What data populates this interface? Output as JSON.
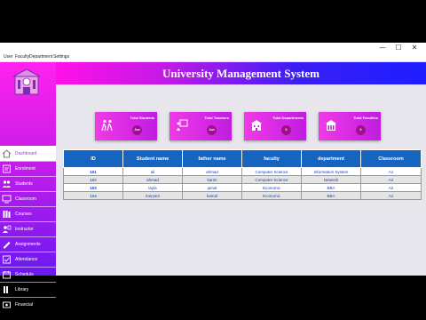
{
  "window": {
    "controls": {
      "minimize": "—",
      "maximize": "☐",
      "close": "✕"
    }
  },
  "menu": [
    "User",
    "Faculty",
    "Department",
    "Settings"
  ],
  "sidebar": {
    "logo_icon": "university-building-logo",
    "items": [
      {
        "label": "Dashboard",
        "icon": "home-icon",
        "active": true
      },
      {
        "label": "Enrolment",
        "icon": "enrolment-icon"
      },
      {
        "label": "Students",
        "icon": "students-icon"
      },
      {
        "label": "Classroom",
        "icon": "classroom-icon"
      },
      {
        "label": "Courses",
        "icon": "courses-icon"
      },
      {
        "label": "Instructor",
        "icon": "instructor-icon"
      },
      {
        "label": "Assignments",
        "icon": "assignments-icon"
      },
      {
        "label": "Attendance",
        "icon": "attendance-icon"
      },
      {
        "label": "Schedule",
        "icon": "schedule-icon"
      },
      {
        "label": "Library",
        "icon": "library-icon"
      },
      {
        "label": "Financial",
        "icon": "financial-icon"
      }
    ]
  },
  "header": {
    "title": "University Management System"
  },
  "cards": [
    {
      "title": "Total Students",
      "value": "Jun",
      "icon": "students-walking-icon"
    },
    {
      "title": "Total Teachers",
      "value": "Jun",
      "icon": "teacher-board-icon"
    },
    {
      "title": "Total Departments",
      "value": "0",
      "icon": "building-icon"
    },
    {
      "title": "Total Faculties",
      "value": "0",
      "icon": "faculty-building-icon"
    }
  ],
  "table": {
    "columns": [
      "ID",
      "Student name",
      "father name",
      "faculty",
      "department",
      "Classroom"
    ],
    "rows": [
      [
        "101",
        "ali",
        "ahmad",
        "Computer Science",
        "Information System",
        "A1"
      ],
      [
        "102",
        "ahmad",
        "karim",
        "Computer Science",
        "Network",
        "A2"
      ],
      [
        "103",
        "layla",
        "jamal",
        "Economic",
        "BBA",
        "A2"
      ],
      [
        "104",
        "maryam",
        "kamal",
        "Economic",
        "BBA",
        "A1"
      ]
    ]
  },
  "colors": {
    "sidebar_top": "#ff22ee",
    "sidebar_bottom": "#6a19f2",
    "header_left": "#ff10e8",
    "header_right": "#1e1eff",
    "table_header": "#1565c0",
    "card": "#e830e4"
  }
}
